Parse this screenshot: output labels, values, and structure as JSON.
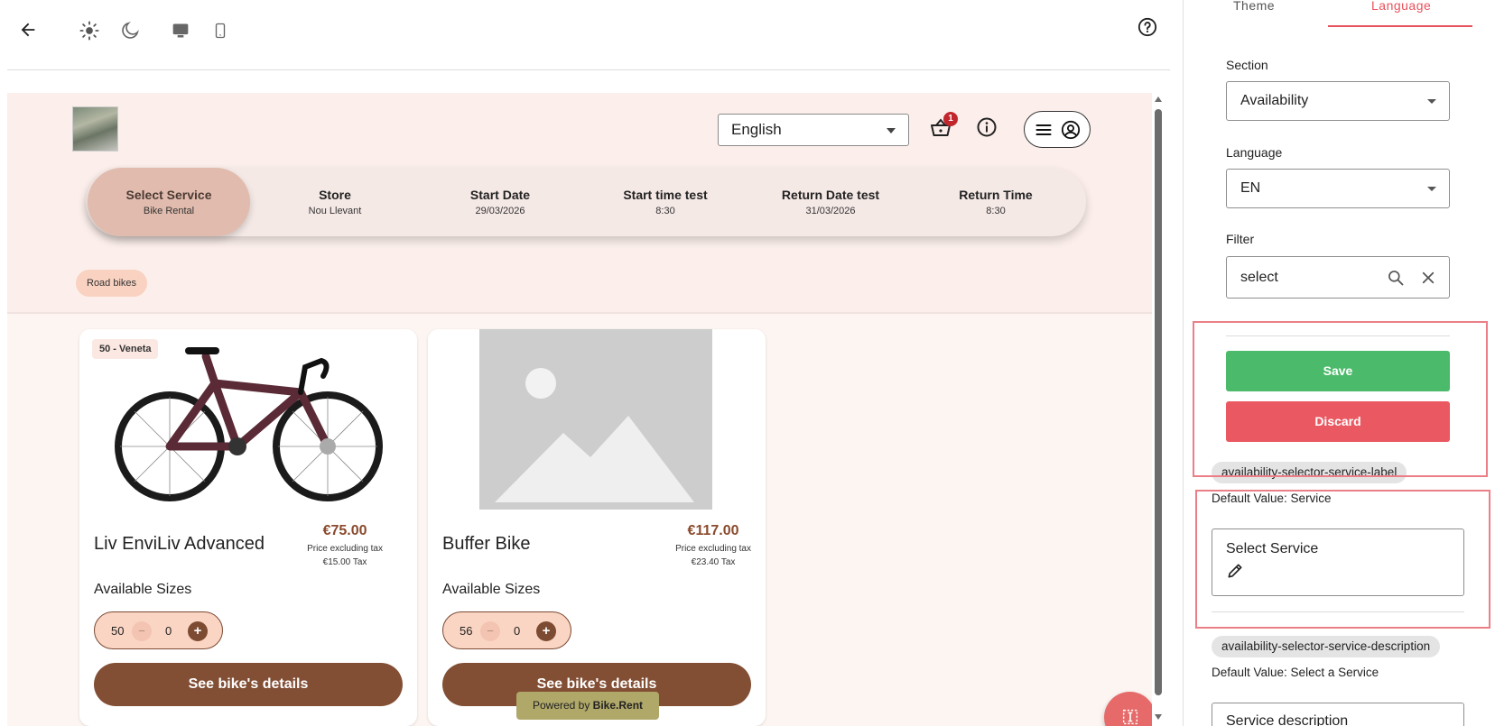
{
  "topbar": {
    "icons": [
      "back-arrow-icon",
      "sun-icon",
      "moon-icon",
      "desktop-icon",
      "mobile-icon",
      "help-icon"
    ]
  },
  "preview": {
    "language_select": "English",
    "cart_count": "1",
    "stepper": [
      {
        "title": "Select Service",
        "sub": "Bike Rental"
      },
      {
        "title": "Store",
        "sub": "Nou Llevant"
      },
      {
        "title": "Start Date",
        "sub": "29/03/2026"
      },
      {
        "title": "Start time test",
        "sub": "8:30"
      },
      {
        "title": "Return Date test",
        "sub": "31/03/2026"
      },
      {
        "title": "Return Time",
        "sub": "8:30"
      }
    ],
    "category_chip": "Road bikes",
    "cards": [
      {
        "badge": "50 - Veneta",
        "name": "Liv EnviLiv Advanced",
        "price": "€75.00",
        "price_note": "Price excluding tax",
        "tax": "€15.00 Tax",
        "sizes_label": "Available Sizes",
        "size": "50",
        "minus": "−",
        "qty": "0",
        "plus": "+",
        "details": "See bike's details"
      },
      {
        "name": "Buffer Bike",
        "price": "€117.00",
        "price_note": "Price excluding tax",
        "tax": "€23.40 Tax",
        "sizes_label": "Available Sizes",
        "size": "56",
        "minus": "−",
        "qty": "0",
        "plus": "+",
        "details": "See bike's details"
      }
    ],
    "powered_prefix": "Powered by ",
    "powered_brand": "Bike.Rent"
  },
  "panel": {
    "tabs": {
      "theme": "Theme",
      "language": "Language"
    },
    "section_label": "Section",
    "section_value": "Availability",
    "language_label": "Language",
    "language_value": "EN",
    "filter_label": "Filter",
    "filter_value": "select",
    "save": "Save",
    "discard": "Discard",
    "entries": [
      {
        "key": "availability-selector-service-label",
        "default": "Default Value: Service",
        "value": "Select Service"
      },
      {
        "key": "availability-selector-service-description",
        "default": "Default Value: Select a Service",
        "value": "Service description"
      }
    ]
  },
  "colors": {
    "accent": "#e8525c",
    "save": "#4cba6b",
    "discard": "#ea5861",
    "brown": "#824f35",
    "highlight": "#eb7f87"
  }
}
